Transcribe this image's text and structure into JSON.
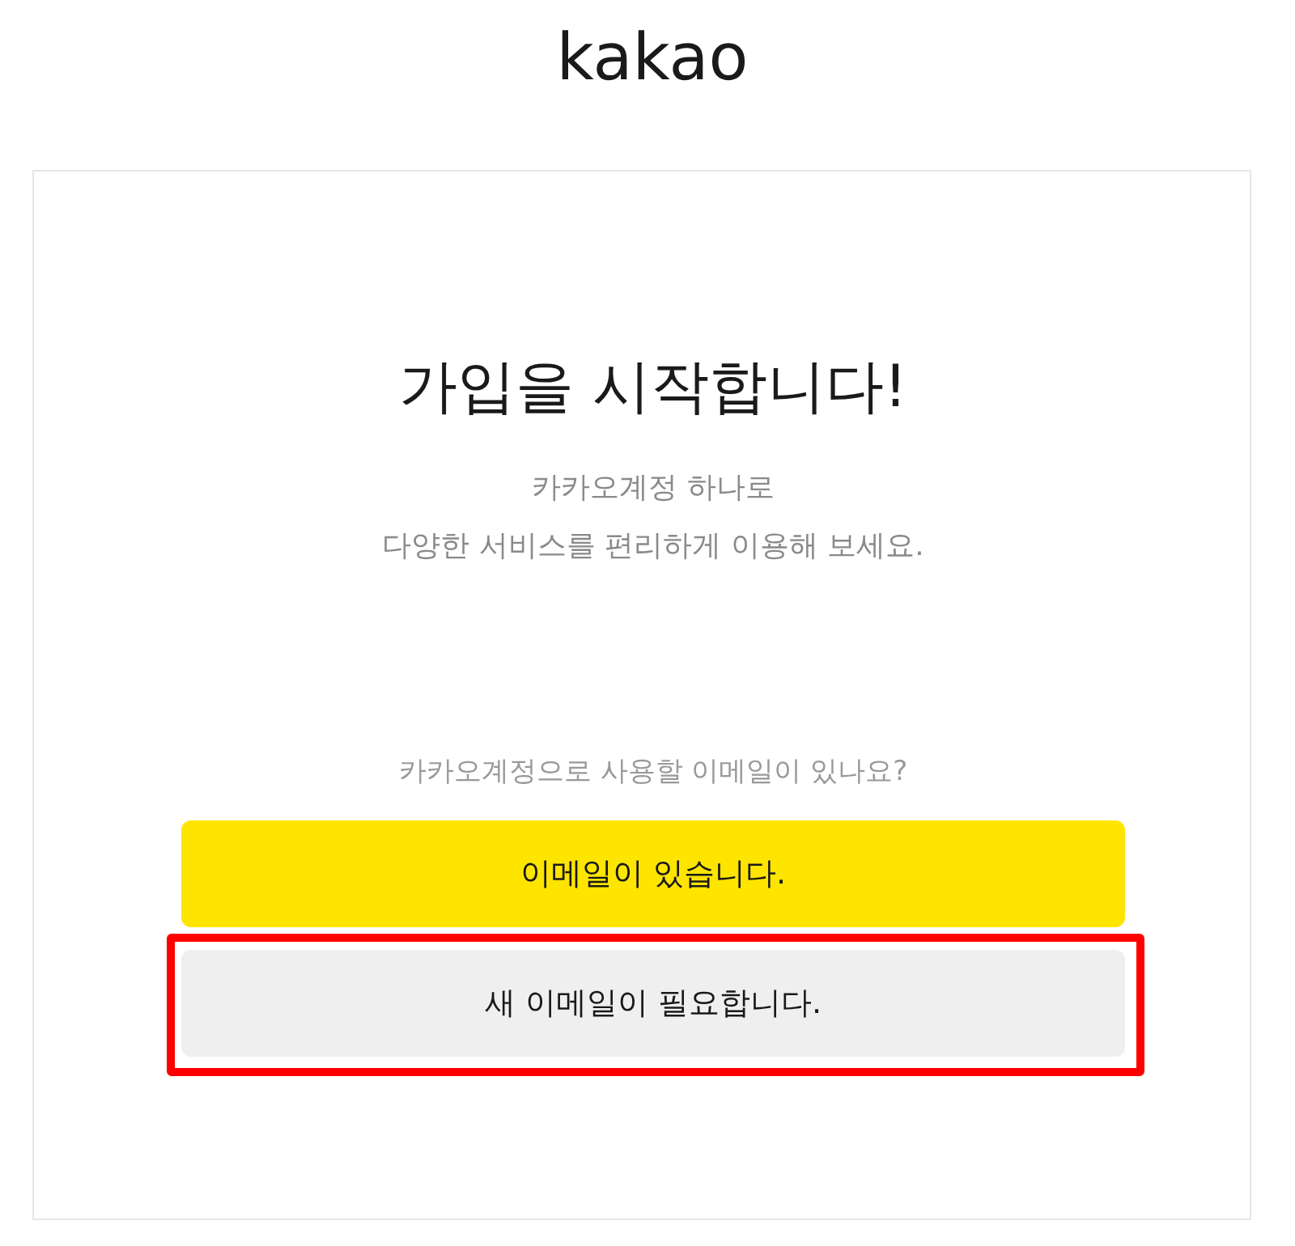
{
  "logo": {
    "text": "kakao"
  },
  "title": "가입을 시작합니다!",
  "subtitle": [
    "카카오계정 하나로",
    "다양한 서비스를 편리하게 이용해 보세요."
  ],
  "question": "카카오계정으로 사용할 이메일이 있나요?",
  "buttons": [
    {
      "kind": "primary",
      "label": "이메일이 있습니다.",
      "highlighted": false
    },
    {
      "kind": "secondary",
      "label": "새 이메일이 필요합니다.",
      "highlighted": true
    }
  ]
}
